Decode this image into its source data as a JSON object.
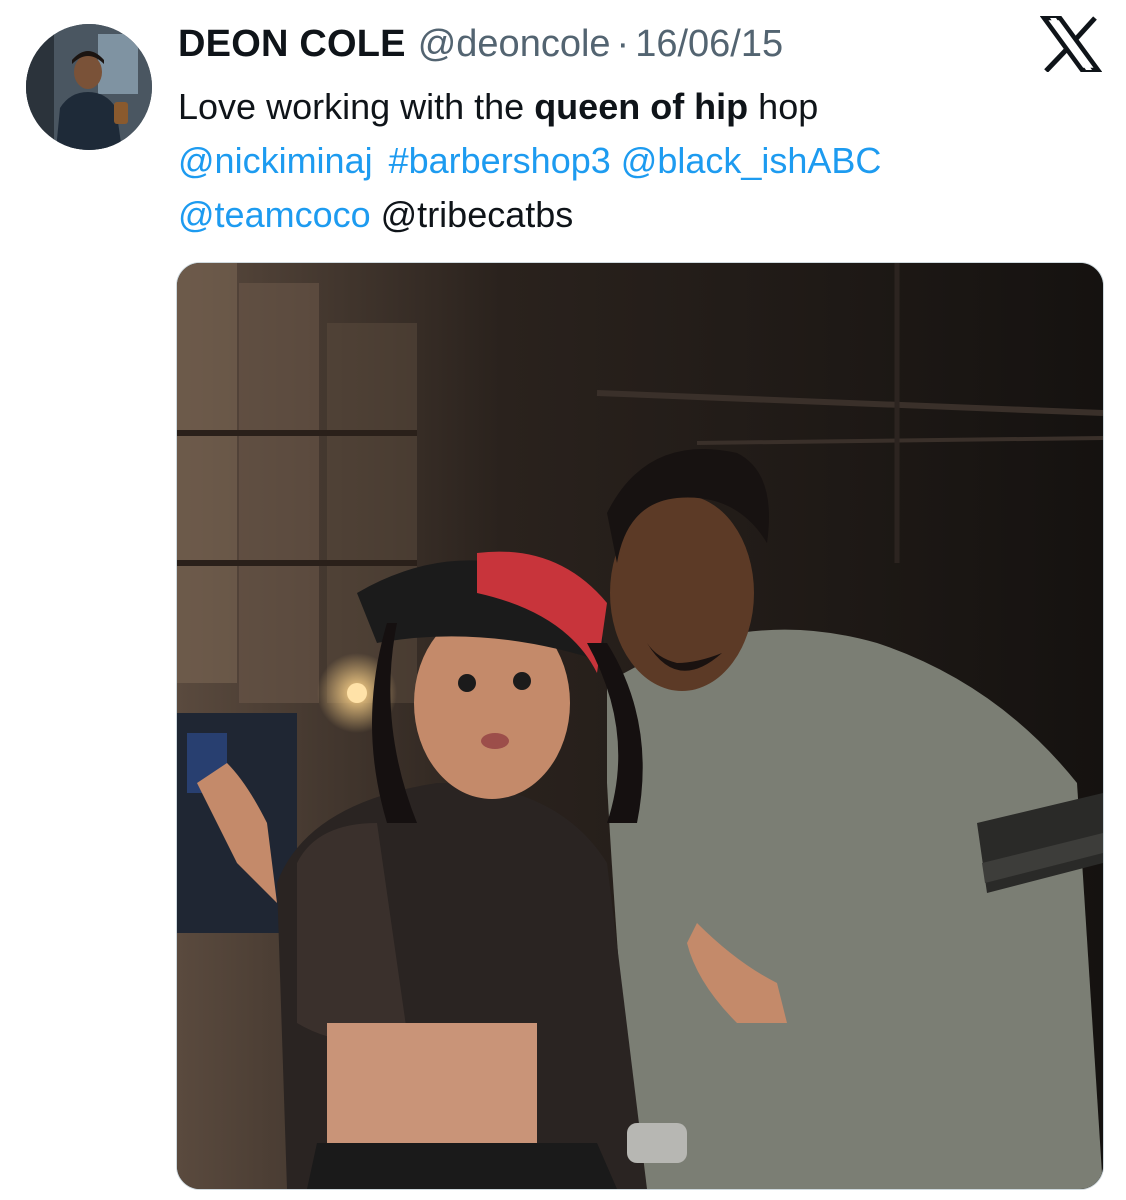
{
  "tweet": {
    "author_name": "DEON COLE",
    "author_handle": "@deoncole",
    "separator": "·",
    "date": "16/06/15",
    "text": {
      "part1": "Love working with the ",
      "bold": "queen of hip",
      "part2": " hop",
      "mentions_line2": [
        "@nickiminaj",
        "#barbershop3",
        "@black_ishABC"
      ],
      "mentions_line3_link": "@teamcoco",
      "mentions_line3_plain": "@tribecatbs"
    }
  },
  "icons": {
    "platform": "x-logo-icon",
    "avatar": "avatar"
  },
  "colors": {
    "link": "#1d9bf0",
    "secondary_text": "#536471",
    "primary_text": "#0f1419"
  }
}
